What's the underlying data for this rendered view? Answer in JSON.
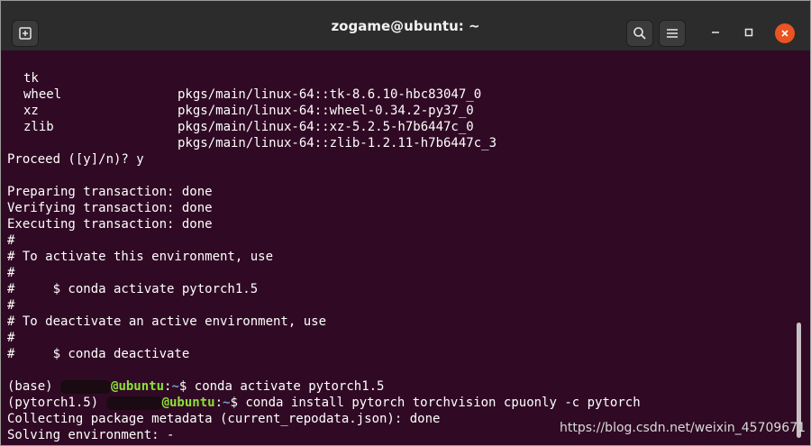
{
  "window": {
    "title": "zogame@ubuntu: ~",
    "icons": {
      "new_tab": "new-tab-icon",
      "search": "search-icon",
      "menu": "hamburger-menu-icon",
      "minimize": "minimize-icon",
      "maximize": "maximize-icon",
      "close": "close-icon"
    },
    "colors": {
      "titlebar": "#2c2c2c",
      "terminal_bg": "#300a24",
      "close_button": "#e95420",
      "prompt_host": "#8ae234",
      "prompt_path": "#729fcf"
    }
  },
  "packages": [
    {
      "name": "tk",
      "path": "pkgs/main/linux-64::tk-8.6.10-hbc83047_0"
    },
    {
      "name": "wheel",
      "path": "pkgs/main/linux-64::wheel-0.34.2-py37_0"
    },
    {
      "name": "xz",
      "path": "pkgs/main/linux-64::xz-5.2.5-h7b6447c_0"
    },
    {
      "name": "zlib",
      "path": "pkgs/main/linux-64::zlib-1.2.11-h7b6447c_3"
    }
  ],
  "output": {
    "proceed": "Proceed ([y]/n)? y",
    "preparing": "Preparing transaction: done",
    "verifying": "Verifying transaction: done",
    "executing": "Executing transaction: done",
    "hash1": "#",
    "activate_hdr": "# To activate this environment, use",
    "hash2": "#",
    "activate_cmd": "#     $ conda activate pytorch1.5",
    "hash3": "#",
    "deactivate_hdr": "# To deactivate an active environment, use",
    "hash4": "#",
    "deactivate_cmd": "#     $ conda deactivate",
    "collecting": "Collecting package metadata (current_repodata.json): done",
    "solving": "Solving environment: -"
  },
  "prompt1": {
    "env": "(base) ",
    "host": "@ubuntu",
    "path": "~",
    "command": "$ conda activate pytorch1.5"
  },
  "prompt2": {
    "env": "(pytorch1.5) ",
    "host": "@ubuntu",
    "path": "~",
    "command": "$ conda install pytorch torchvision cpuonly -c pytorch"
  },
  "watermark": "https://blog.csdn.net/weixin_45709671"
}
